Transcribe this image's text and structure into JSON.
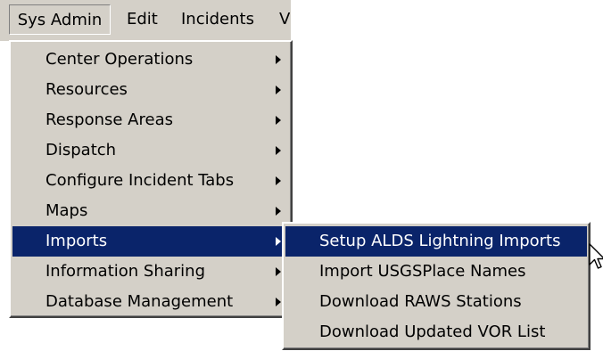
{
  "menubar": {
    "items": [
      {
        "label": "Sys Admin"
      },
      {
        "label": "Edit"
      },
      {
        "label": "Incidents"
      },
      {
        "label": "V"
      }
    ]
  },
  "sys_admin_menu": {
    "items": [
      {
        "label": "Center Operations"
      },
      {
        "label": "Resources"
      },
      {
        "label": "Response Areas"
      },
      {
        "label": "Dispatch"
      },
      {
        "label": "Configure Incident Tabs"
      },
      {
        "label": "Maps"
      },
      {
        "label": "Imports"
      },
      {
        "label": "Information Sharing"
      },
      {
        "label": "Database Management"
      }
    ],
    "highlighted": "Imports"
  },
  "imports_submenu": {
    "items": [
      {
        "label": "Setup ALDS Lightning Imports"
      },
      {
        "label": "Import USGSPlace Names"
      },
      {
        "label": "Download RAWS Stations"
      },
      {
        "label": "Download Updated VOR List"
      }
    ],
    "highlighted": "Setup ALDS Lightning Imports"
  },
  "theme": {
    "menu_bg": "#d4d0c8",
    "highlight_bg": "#0a246a",
    "highlight_text": "#ffffff"
  },
  "icons": {
    "submenu_arrow": "chevron-right-icon",
    "cursor": "mouse-pointer-icon"
  }
}
